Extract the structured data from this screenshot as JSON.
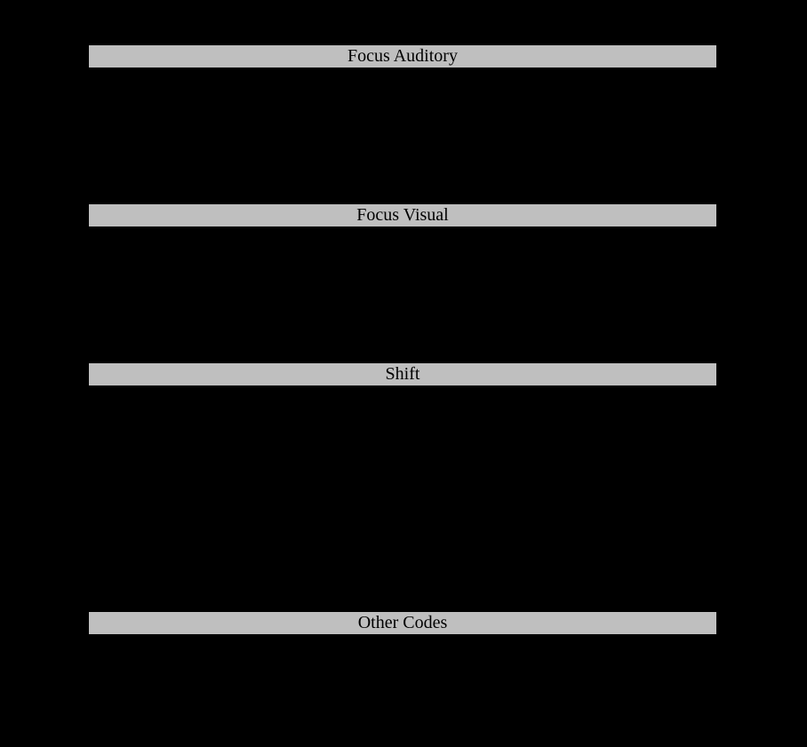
{
  "sections": [
    {
      "title": "Focus Auditory"
    },
    {
      "title": "Focus Visual"
    },
    {
      "title": "Shift"
    },
    {
      "title": "Other Codes"
    }
  ],
  "colors": {
    "background": "#000000",
    "header_fill": "#bfbfbf",
    "header_text": "#000000"
  }
}
